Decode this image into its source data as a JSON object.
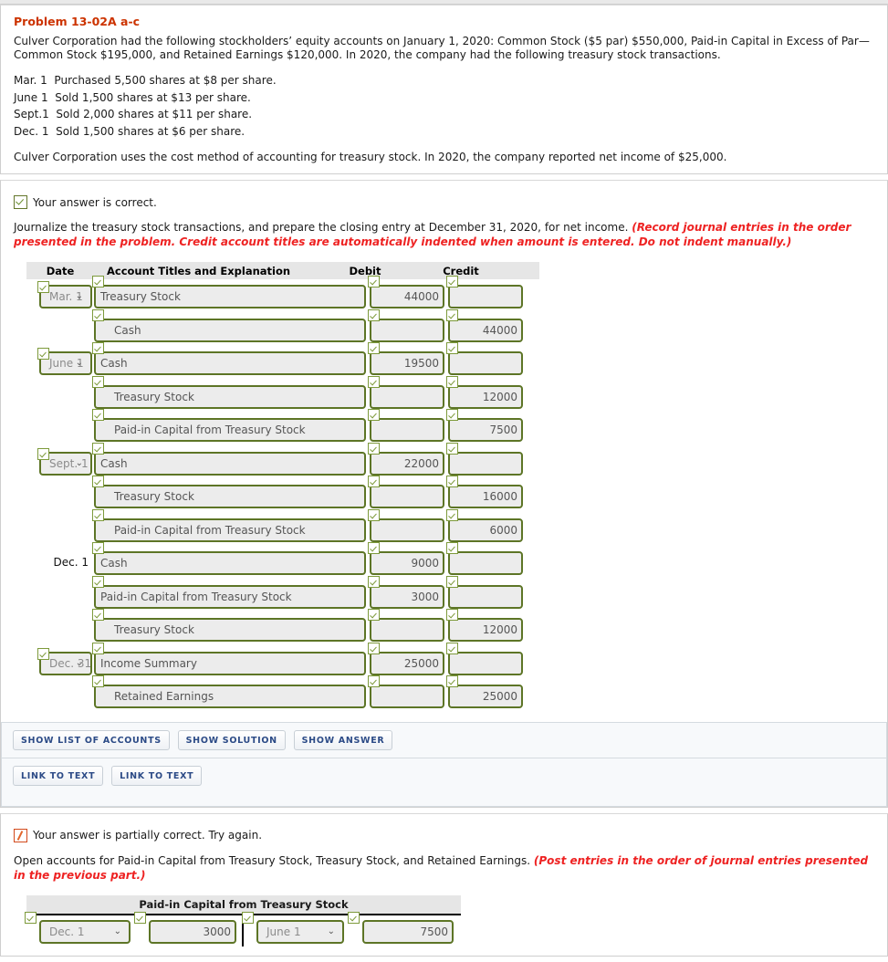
{
  "problem": {
    "title": "Problem 13-02A a-c",
    "intro": "Culver Corporation had the following stockholders’ equity accounts on January 1, 2020: Common Stock ($5 par) $550,000, Paid-in Capital in Excess of Par—Common Stock $195,000, and Retained Earnings $120,000. In 2020, the company had the following treasury stock transactions.",
    "transactions": [
      "Mar. 1  Purchased 5,500 shares at $8 per share.",
      "June 1  Sold 1,500 shares at $13 per share.",
      "Sept.1  Sold 2,000 shares at $11 per share.",
      "Dec. 1  Sold 1,500 shares at $6 per share."
    ],
    "closing_note": "Culver Corporation uses the cost method of accounting for treasury stock. In 2020, the company reported net income of $25,000."
  },
  "part_a": {
    "status": "Your answer is correct.",
    "instruction_plain": "Journalize the treasury stock transactions, and prepare the closing entry at December 31, 2020, for net income. ",
    "instruction_red": "(Record journal entries in the order presented in the problem. Credit account titles are automatically indented when amount is entered. Do not indent manually.)",
    "table": {
      "headers": [
        "Date",
        "Account Titles and Explanation",
        "Debit",
        "Credit"
      ],
      "rows": [
        {
          "date": "Mar. 1",
          "date_type": "select",
          "account": "Treasury Stock",
          "indent": false,
          "debit": "44000",
          "credit": ""
        },
        {
          "date": "",
          "date_type": "none",
          "account": "Cash",
          "indent": true,
          "debit": "",
          "credit": "44000"
        },
        {
          "date": "June 1",
          "date_type": "select",
          "account": "Cash",
          "indent": false,
          "debit": "19500",
          "credit": ""
        },
        {
          "date": "",
          "date_type": "none",
          "account": "Treasury Stock",
          "indent": true,
          "debit": "",
          "credit": "12000"
        },
        {
          "date": "",
          "date_type": "none",
          "account": "Paid-in Capital from Treasury Stock",
          "indent": true,
          "debit": "",
          "credit": "7500"
        },
        {
          "date": "Sept. 1",
          "date_type": "select",
          "account": "Cash",
          "indent": false,
          "debit": "22000",
          "credit": ""
        },
        {
          "date": "",
          "date_type": "none",
          "account": "Treasury Stock",
          "indent": true,
          "debit": "",
          "credit": "16000"
        },
        {
          "date": "",
          "date_type": "none",
          "account": "Paid-in Capital from Treasury Stock",
          "indent": true,
          "debit": "",
          "credit": "6000"
        },
        {
          "date": "Dec. 1",
          "date_type": "text",
          "account": "Cash",
          "indent": false,
          "debit": "9000",
          "credit": ""
        },
        {
          "date": "",
          "date_type": "none",
          "account": "Paid-in Capital from Treasury Stock",
          "indent": false,
          "debit": "3000",
          "credit": ""
        },
        {
          "date": "",
          "date_type": "none",
          "account": "Treasury Stock",
          "indent": true,
          "debit": "",
          "credit": "12000"
        },
        {
          "date": "Dec. 31",
          "date_type": "select",
          "account": "Income Summary",
          "indent": false,
          "debit": "25000",
          "credit": ""
        },
        {
          "date": "",
          "date_type": "none",
          "account": "Retained Earnings",
          "indent": true,
          "debit": "",
          "credit": "25000"
        }
      ]
    },
    "buttons_row1": [
      "SHOW LIST OF ACCOUNTS",
      "SHOW SOLUTION",
      "SHOW ANSWER"
    ],
    "buttons_row2": [
      "LINK TO TEXT",
      "LINK TO TEXT"
    ]
  },
  "part_b": {
    "status": "Your answer is partially correct.  Try again.",
    "instruction_plain": "Open accounts for Paid-in Capital from Treasury Stock, Treasury Stock, and Retained Earnings. ",
    "instruction_red": "(Post entries in the order of journal entries presented in the previous part.)",
    "taccount": {
      "title": "Paid-in Capital from Treasury Stock",
      "rows": [
        {
          "debit_date": "Dec. 1",
          "debit_amount": "3000",
          "credit_date": "June 1",
          "credit_amount": "7500"
        }
      ]
    }
  },
  "icons": {
    "check": "check-icon",
    "slash": "slash-icon",
    "caret": "chevron-down-icon"
  },
  "colors": {
    "title_orange": "#cc3300",
    "instruction_red": "#ee2222",
    "field_border_green": "#5d7526",
    "field_fill": "#ececec",
    "header_grey": "#e6e6e6",
    "button_blue": "#2b4a86"
  }
}
